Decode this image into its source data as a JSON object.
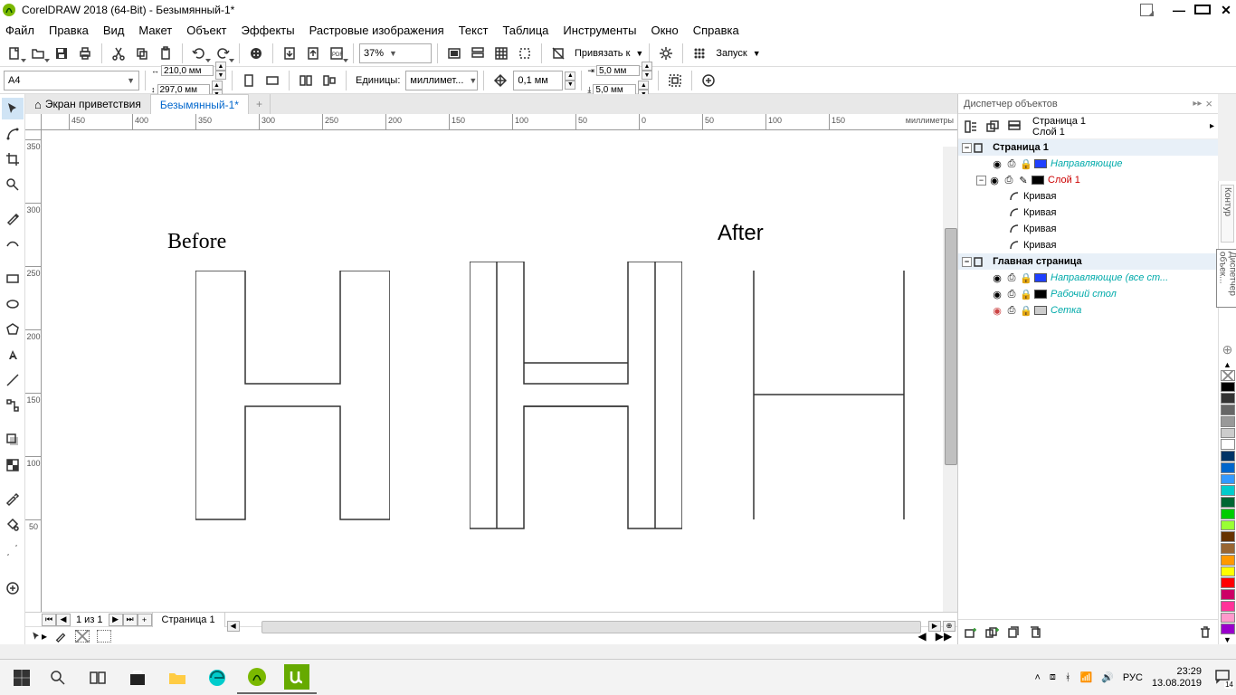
{
  "titlebar": {
    "app": "CorelDRAW 2018 (64-Bit) - Безымянный-1*"
  },
  "menu": [
    "Файл",
    "Правка",
    "Вид",
    "Макет",
    "Объект",
    "Эффекты",
    "Растровые изображения",
    "Текст",
    "Таблица",
    "Инструменты",
    "Окно",
    "Справка"
  ],
  "toolbar1": {
    "zoom": "37%",
    "snap_label": "Привязать к",
    "launch_label": "Запуск"
  },
  "propbar": {
    "page_preset": "A4",
    "width": "210,0 мм",
    "height": "297,0 мм",
    "units_label": "Единицы:",
    "units": "миллимет...",
    "nudge": "0,1 мм",
    "dup_x": "5,0 мм",
    "dup_y": "5,0 мм"
  },
  "doctabs": {
    "welcome": "Экран приветствия",
    "doc": "Безымянный-1*"
  },
  "ruler": {
    "h_ticks": [
      "450",
      "400",
      "350",
      "300",
      "250",
      "200",
      "150",
      "100",
      "50",
      "0",
      "50",
      "100",
      "150"
    ],
    "unit": "миллиметры",
    "v_ticks": [
      "350",
      "300",
      "250",
      "200",
      "150",
      "100",
      "50"
    ]
  },
  "canvas": {
    "before": "Before",
    "after": "After"
  },
  "pagenav": {
    "count": "1 из 1",
    "tab": "Страница 1"
  },
  "docker": {
    "title": "Диспетчер объектов",
    "page_lbl": "Страница 1",
    "layer_lbl": "Слой 1",
    "page1": "Страница 1",
    "guides": "Направляющие",
    "layer1": "Слой 1",
    "curve": "Кривая",
    "master": "Главная страница",
    "master_guides": "Направляющие (все ст...",
    "desktop": "Рабочий стол",
    "grid": "Сетка"
  },
  "colorbar_labels": [
    "Контур",
    "Диспетчер объек..."
  ],
  "taskbar": {
    "lang": "РУС",
    "time": "23:29",
    "date": "13.08.2019",
    "notify_count": "14"
  }
}
